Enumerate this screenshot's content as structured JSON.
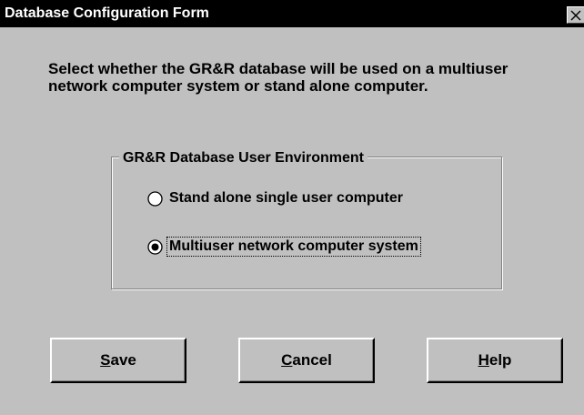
{
  "window": {
    "title": "Database Configuration Form"
  },
  "instructions": "Select whether the GR&R database will be used on a multiuser network computer system or stand alone computer.",
  "group": {
    "title": "GR&R Database User Environment",
    "options": [
      {
        "label": "Stand alone single user computer",
        "selected": false
      },
      {
        "label": "Multiuser network computer system",
        "selected": true
      }
    ]
  },
  "buttons": {
    "save": {
      "mnemonic": "S",
      "rest": "ave"
    },
    "cancel": {
      "mnemonic": "C",
      "rest": "ancel"
    },
    "help": {
      "mnemonic": "H",
      "rest": "elp"
    }
  },
  "colors": {
    "face": "#c0c0c0",
    "titlebar": "#000000",
    "title_text": "#ffffff"
  },
  "icons": {
    "close": "close-icon",
    "radio": "radio-button-icon"
  }
}
